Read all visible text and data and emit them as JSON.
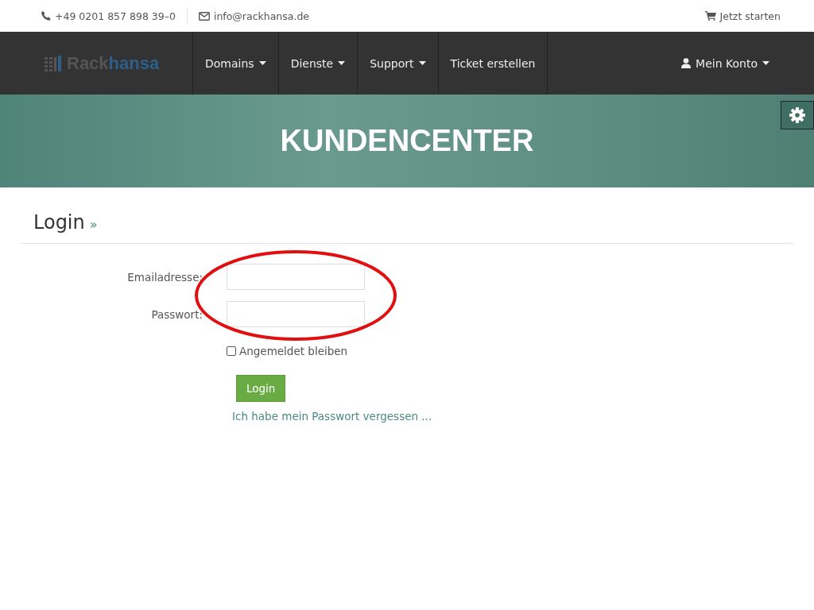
{
  "topbar": {
    "phone": "+49 0201 857 898 39–0",
    "email": "info@rackhansa.de",
    "cta": "Jetzt starten"
  },
  "logo": {
    "first": "Rack",
    "second": "hansa"
  },
  "nav": [
    {
      "label": "Domains",
      "dropdown": true
    },
    {
      "label": "Dienste",
      "dropdown": true
    },
    {
      "label": "Support",
      "dropdown": true
    },
    {
      "label": "Ticket erstellen",
      "dropdown": false
    }
  ],
  "account": {
    "label": "Mein Konto",
    "dropdown": true
  },
  "hero": {
    "title": "KUNDENCENTER"
  },
  "page": {
    "title": "Login",
    "title_mark": "»"
  },
  "form": {
    "fields": [
      {
        "label": "Emailadresse:"
      },
      {
        "label": "Passwort:"
      }
    ],
    "remember": {
      "label": "Angemeldet bleiben",
      "checked": false
    },
    "submit": "Login",
    "forgot": "Ich habe mein Passwort vergessen ..."
  }
}
